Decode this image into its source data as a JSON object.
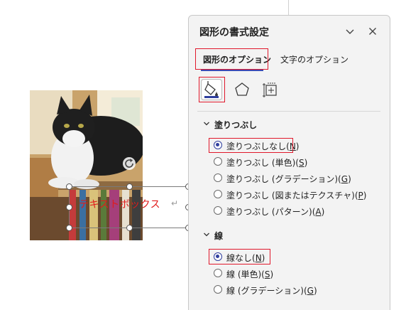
{
  "pane": {
    "title": "図形の書式設定",
    "tabs": [
      {
        "label": "図形のオプション",
        "selected": true
      },
      {
        "label": "文字のオプション",
        "selected": false
      }
    ],
    "categories": [
      "fill-line-icon",
      "effects-pentagon-icon",
      "size-properties-icon"
    ],
    "fill_section": {
      "header": "塗りつぶし",
      "options": [
        {
          "pre": "塗りつぶしなし(",
          "key": "N",
          "post": ")",
          "selected": true
        },
        {
          "pre": "塗りつぶし (単色)(",
          "key": "S",
          "post": ")",
          "selected": false
        },
        {
          "pre": "塗りつぶし (グラデーション)(",
          "key": "G",
          "post": ")",
          "selected": false
        },
        {
          "pre": "塗りつぶし (図またはテクスチャ)(",
          "key": "P",
          "post": ")",
          "selected": false
        },
        {
          "pre": "塗りつぶし (パターン)(",
          "key": "A",
          "post": ")",
          "selected": false
        }
      ]
    },
    "line_section": {
      "header": "線",
      "options": [
        {
          "pre": "線なし(",
          "key": "N",
          "post": ")",
          "selected": true
        },
        {
          "pre": "線 (単色)(",
          "key": "S",
          "post": ")",
          "selected": false
        },
        {
          "pre": "線 (グラデーション)(",
          "key": "G",
          "post": ")",
          "selected": false
        }
      ]
    }
  },
  "document": {
    "textbox_text": "テキストボックス",
    "paragraph_mark": "↵"
  },
  "colors": {
    "accent": "#2f3f9e",
    "highlight_box": "#e0182b",
    "textbox_text": "#e11b1b"
  }
}
